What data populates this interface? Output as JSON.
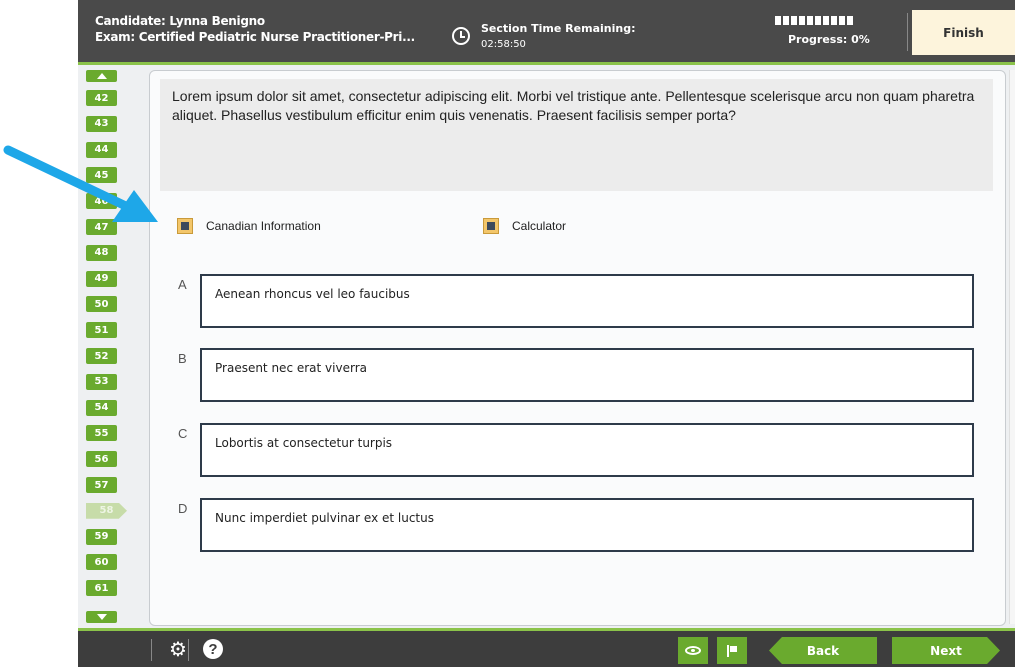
{
  "header": {
    "candidate": "Candidate: Lynna Benigno",
    "exam": "Exam: Certified Pediatric Nurse Practitioner-Pri...",
    "time_label": "Section Time Remaining:",
    "time_value": "02:58:50",
    "progress_label": "Progress: 0%",
    "progress": 0,
    "finish_label": "Finish"
  },
  "sidebar": {
    "items": [
      "42",
      "43",
      "44",
      "45",
      "46",
      "47",
      "48",
      "49",
      "50",
      "51",
      "52",
      "53",
      "54",
      "55",
      "56",
      "57",
      "58",
      "59",
      "60",
      "61"
    ],
    "current": "58"
  },
  "question": {
    "text": "Lorem ipsum dolor sit amet, consectetur adipiscing elit. Morbi vel tristique ante. Pellentesque scelerisque arcu non quam pharetra aliquet. Phasellus vestibulum efficitur enim quis venenatis. Praesent facilisis semper porta?"
  },
  "tools": {
    "exhibit_label": "Canadian Information",
    "calculator_label": "Calculator"
  },
  "options": [
    {
      "letter": "A",
      "text": "Aenean rhoncus vel leo faucibus"
    },
    {
      "letter": "B",
      "text": "Praesent nec erat viverra"
    },
    {
      "letter": "C",
      "text": "Lobortis at consectetur turpis"
    },
    {
      "letter": "D",
      "text": "Nunc imperdiet pulvinar ex et luctus"
    }
  ],
  "footer": {
    "back_label": "Back",
    "next_label": "Next",
    "help_glyph": "?"
  },
  "colors": {
    "accent_green": "#6aaa2e",
    "header_bg": "#4a4a4a",
    "annotation_blue": "#1ea7e8"
  }
}
